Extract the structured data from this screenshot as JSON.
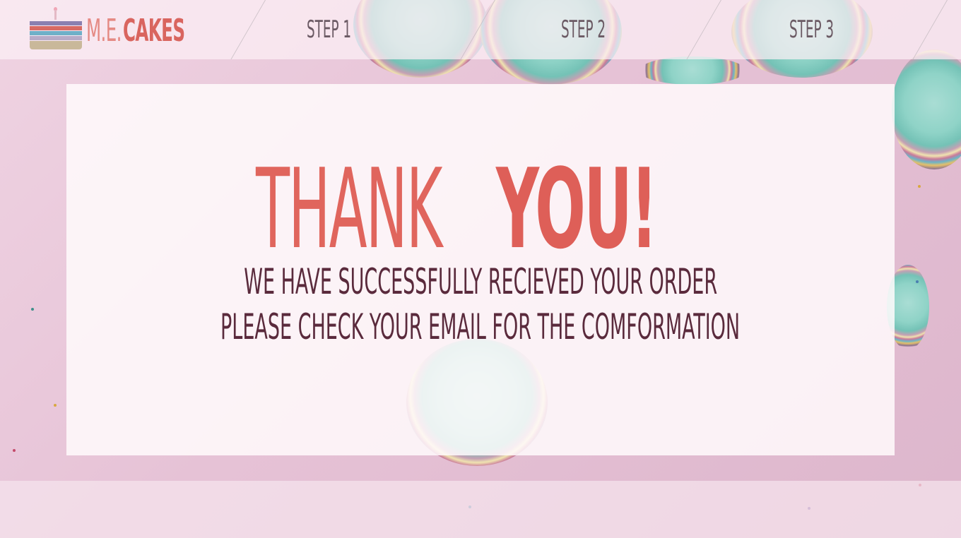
{
  "brand": {
    "thin": "M.E.",
    "bold": "CAKES"
  },
  "nav": {
    "steps": [
      "STEP 1",
      "STEP 2",
      "STEP 3"
    ]
  },
  "main": {
    "heading_thin": "THANK",
    "heading_bold": "YOU!",
    "line1": "WE HAVE SUCCESSFULLY RECIEVED YOUR ORDER",
    "line2": "PLEASE CHECK YOUR EMAIL FOR THE COMFORMATION"
  },
  "colors": {
    "accent": "#de5f58",
    "text_dark": "#5a2a3c",
    "logo_layers": [
      "#8a80b0",
      "#d76a63",
      "#6fb0c8",
      "#b7abc8",
      "#c9b89a"
    ]
  }
}
